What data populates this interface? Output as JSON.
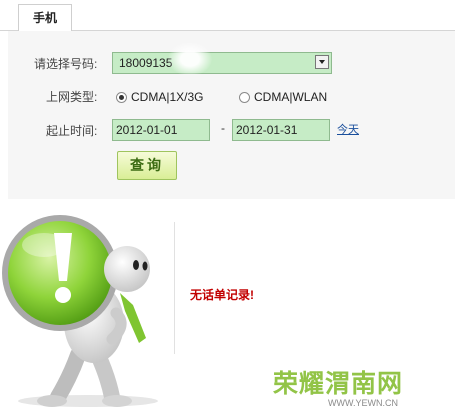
{
  "tabs": {
    "active": "手机"
  },
  "form": {
    "phone_label": "请选择号码:",
    "phone_value": "18009135",
    "type_label": "上网类型:",
    "radio_options": [
      {
        "label": "CDMA|1X/3G",
        "selected": true
      },
      {
        "label": "CDMA|WLAN",
        "selected": false
      }
    ],
    "date_label": "起止时间:",
    "start_date": "2012-01-01",
    "date_separator": "-",
    "end_date": "2012-01-31",
    "today_link": "今天",
    "query_button": "查询"
  },
  "result": {
    "message": "无话单记录!"
  },
  "watermark": {
    "brand": "荣耀渭南网",
    "url": "WWW.YEWN.CN"
  },
  "colors": {
    "input_bg": "#c6ecc6",
    "error_text": "#c20000",
    "accent_green": "#92c447",
    "link": "#1a4f9c"
  },
  "icons": [
    "dropdown-arrow-icon",
    "exclamation-icon",
    "character-mascot"
  ]
}
